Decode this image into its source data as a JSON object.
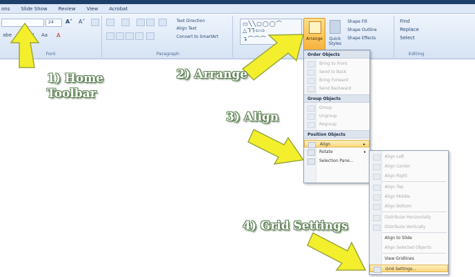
{
  "tabs": [
    "ons",
    "Slide Show",
    "Review",
    "View",
    "Acrobat"
  ],
  "ribbon": {
    "font": {
      "label": "Font",
      "size": "24"
    },
    "paragraph": {
      "label": "Paragraph",
      "text_direction": "Text Direction",
      "align_text": "Align Text",
      "convert_smartart": "Convert to SmartArt"
    },
    "drawing": {
      "arrange": "Arrange",
      "quick_styles": "Quick Styles",
      "shape_fill": "Shape Fill",
      "shape_outline": "Shape Outline",
      "shape_effects": "Shape Effects"
    },
    "editing": {
      "label": "Editing",
      "find": "Find",
      "replace": "Replace",
      "select": "Select"
    }
  },
  "annotations": {
    "step1": "1) Home",
    "step1b": "Toolbar",
    "step2": "2) Arrange",
    "step3": "3) Align",
    "step4": "4) Grid Settings"
  },
  "arrange_menu": {
    "order_header": "Order Objects",
    "bring_to_front": "Bring to Front",
    "send_to_back": "Send to Back",
    "bring_forward": "Bring Forward",
    "send_backward": "Send Backward",
    "group_header": "Group Objects",
    "group": "Group",
    "ungroup": "Ungroup",
    "regroup": "Regroup",
    "position_header": "Position Objects",
    "align": "Align",
    "rotate": "Rotate",
    "selection_pane": "Selection Pane..."
  },
  "align_menu": {
    "align_left": "Align Left",
    "align_center": "Align Center",
    "align_right": "Align Right",
    "align_top": "Align Top",
    "align_middle": "Align Middle",
    "align_bottom": "Align Bottom",
    "distribute_h": "Distribute Horizontally",
    "distribute_v": "Distribute Vertically",
    "align_to_slide": "Align to Slide",
    "align_selected": "Align Selected Objects",
    "view_gridlines": "View Gridlines",
    "grid_settings": "Grid Settings..."
  },
  "colors": {
    "arrow_fill": "#f4ef2c",
    "arrow_stroke": "#9aa53a",
    "note_outline": "#5c7f52",
    "highlight": "#fcd67a"
  }
}
